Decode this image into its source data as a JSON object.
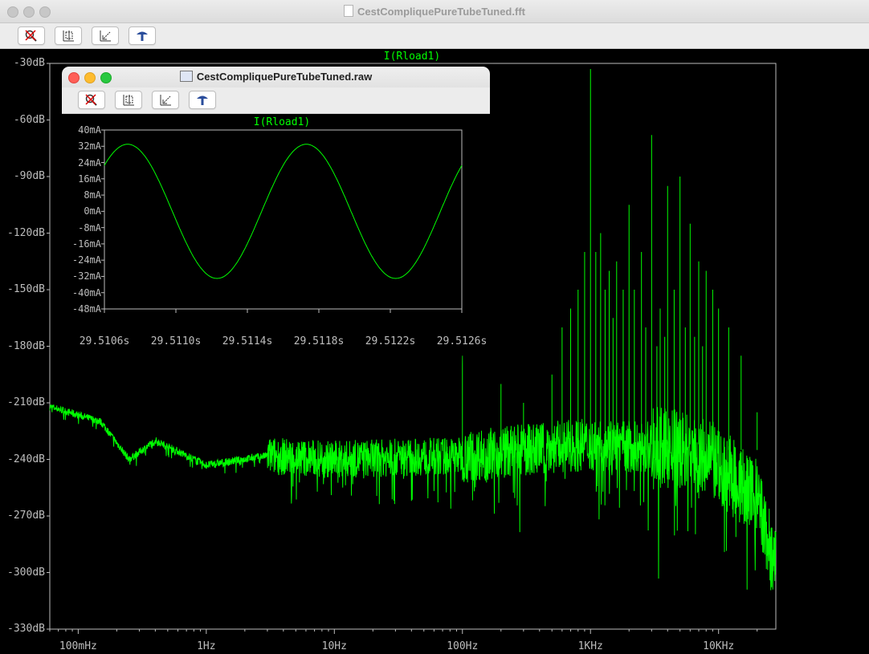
{
  "main_window": {
    "title": "CestCompliquePureTubeTuned.fft",
    "trace_label": "I(Rload1)",
    "y_ticks": [
      "-30dB",
      "-60dB",
      "-90dB",
      "-120dB",
      "-150dB",
      "-180dB",
      "-210dB",
      "-240dB",
      "-270dB",
      "-300dB",
      "-330dB"
    ],
    "x_ticks": [
      "100mHz",
      "1Hz",
      "10Hz",
      "100Hz",
      "1KHz",
      "10KHz"
    ],
    "toolbar": [
      "zoom-cancel-icon",
      "autorange-icon",
      "back-pan-icon",
      "pick-trace-icon"
    ]
  },
  "sub_window": {
    "title": "CestCompliquePureTubeTuned.raw",
    "trace_label": "I(Rload1)",
    "y_ticks": [
      "40mA",
      "32mA",
      "24mA",
      "16mA",
      "8mA",
      "0mA",
      "-8mA",
      "-16mA",
      "-24mA",
      "-32mA",
      "-40mA",
      "-48mA"
    ],
    "x_ticks": [
      "29.5106s",
      "29.5110s",
      "29.5114s",
      "29.5118s",
      "29.5122s",
      "29.5126s"
    ]
  },
  "colors": {
    "trace": "#00ff00",
    "background": "#000000",
    "axis": "#bdbdbd"
  },
  "chart_data": [
    {
      "type": "line",
      "title": "I(Rload1)",
      "xscale": "log",
      "xlim": [
        0.06,
        28000
      ],
      "ylim": [
        -330,
        -30
      ],
      "x_ticks": [
        0.1,
        1,
        10,
        100,
        1000,
        10000
      ],
      "noise_floor": {
        "x": [
          0.06,
          0.15,
          0.25,
          0.4,
          1,
          3,
          10,
          100,
          1000,
          5000,
          10000,
          20000,
          28000
        ],
        "y": [
          -212,
          -220,
          -240,
          -230,
          -243,
          -238,
          -240,
          -238,
          -232,
          -235,
          -243,
          -262,
          -300
        ]
      },
      "peaks": {
        "x": [
          1000,
          2000,
          3000,
          4000,
          5000,
          6000,
          7000,
          8000,
          9000,
          10000
        ],
        "y": [
          -33,
          -105,
          -68,
          -95,
          -90,
          -115,
          -135,
          -140,
          -150,
          -160
        ]
      },
      "grid": false
    },
    {
      "type": "line",
      "title": "I(Rload1)",
      "xlim": [
        29.5106,
        29.5126
      ],
      "ylim": [
        -48,
        40
      ],
      "amplitude_mA": 33,
      "period_s": 0.001,
      "peaks_s": [
        29.51073,
        29.51173
      ],
      "troughs_s": [
        29.51123,
        29.51223
      ],
      "grid": false
    }
  ]
}
